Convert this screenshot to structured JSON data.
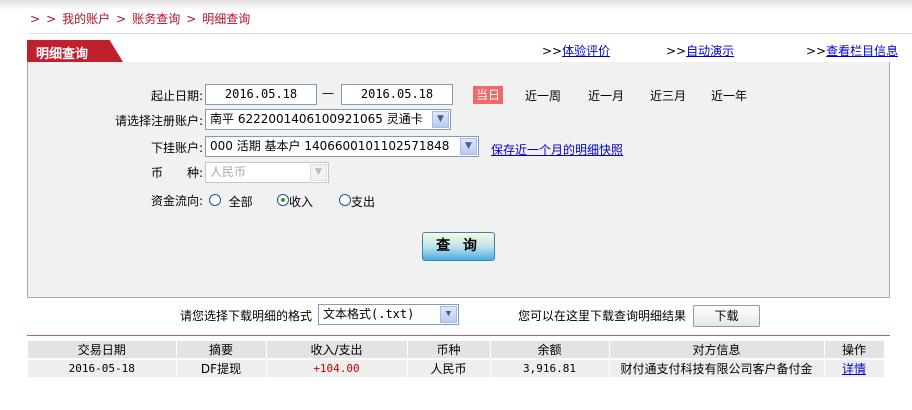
{
  "breadcrumb": [
    ">",
    ">",
    "我的账户",
    ">",
    "账务查询",
    ">",
    "明细查询"
  ],
  "tab_title": "明细查询",
  "top_links": [
    {
      "prefix": ">>",
      "label": "体验评价"
    },
    {
      "prefix": ">>",
      "label": "自动演示"
    },
    {
      "prefix": ">>",
      "label": "查看栏目信息"
    }
  ],
  "form": {
    "date_label": "起止日期:",
    "start_date": "2016.05.18",
    "dash": "—",
    "end_date": "2016.05.18",
    "quick_ranges": [
      "当日",
      "近一周",
      "近一月",
      "近三月",
      "近一年"
    ],
    "quick_selected": "当日",
    "reg_account_label": "请选择注册账户:",
    "reg_account": "南平 6222001406100921065 灵通卡",
    "sub_account_label": "下挂账户:",
    "sub_account": "000 活期 基本户 1406600101102571848",
    "snapshot_link": "保存近一个月的明细快照",
    "currency_label": "币　　种:",
    "currency": "人民币",
    "flow_label": "资金流向:",
    "flow_options": [
      "全部",
      "收入",
      "支出"
    ],
    "flow_selected": "收入",
    "query_button": "查 询"
  },
  "download": {
    "format_label": "请您选择下载明细的格式",
    "format": "文本格式(.txt)",
    "hint": "您可以在这里下载查询明细结果",
    "button": "下载"
  },
  "table": {
    "headers": [
      "交易日期",
      "摘要",
      "收入/支出",
      "币种",
      "余额",
      "对方信息",
      "操作"
    ],
    "rows": [
      [
        "2016-05-18",
        "DF提现",
        "+104.00",
        "人民币",
        "3,916.81",
        "财付通支付科技有限公司客户备付金",
        "详情"
      ]
    ]
  },
  "colors": {
    "brand_red": "#c0202e",
    "income": "#cc0000",
    "link": "#0000cc"
  }
}
